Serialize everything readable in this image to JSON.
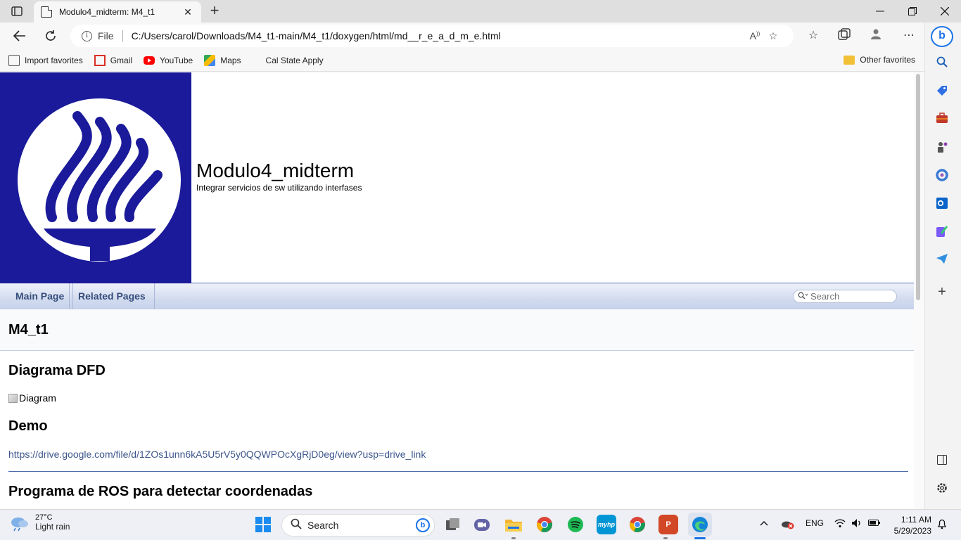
{
  "browser": {
    "tab_title": "Modulo4_midterm: M4_t1",
    "tab_close": "✕",
    "new_tab": "+",
    "address_prefix": "File",
    "url": "C:/Users/carol/Downloads/M4_t1-main/M4_t1/doxygen/html/md__r_e_a_d_m_e.html",
    "favorites": [
      {
        "label": "Import favorites",
        "icon": "import-favorites-icon"
      },
      {
        "label": "Gmail",
        "icon": "gmail-icon"
      },
      {
        "label": "YouTube",
        "icon": "youtube-icon"
      },
      {
        "label": "Maps",
        "icon": "maps-icon"
      },
      {
        "label": "Cal State Apply",
        "icon": "page-icon"
      }
    ],
    "other_favorites": "Other favorites",
    "sidebar_add": "+"
  },
  "doxygen": {
    "project_name": "Modulo4_midterm",
    "project_brief": "Integrar servicios de sw utilizando interfases",
    "nav": {
      "main_page": "Main Page",
      "related_pages": "Related Pages",
      "search_placeholder": "Search"
    },
    "page_title": "M4_t1",
    "sections": {
      "diagram_heading": "Diagrama DFD",
      "diagram_alt": "Diagram",
      "demo_heading": "Demo",
      "demo_link": "https://drive.google.com/file/d/1ZOs1unn6kA5U5rV5y0QQWPOcXgRjD0eg/view?usp=drive_link",
      "ros_heading": "Programa de ROS para detectar coordenadas"
    }
  },
  "taskbar": {
    "weather_temp": "27°C",
    "weather_desc": "Light rain",
    "search_label": "Search",
    "language": "ENG",
    "time": "1:11 AM",
    "date": "5/29/2023"
  },
  "colors": {
    "logo_bg": "#1a1a9a",
    "doxygen_nav_text": "#364d7c",
    "link": "#3d578c"
  }
}
